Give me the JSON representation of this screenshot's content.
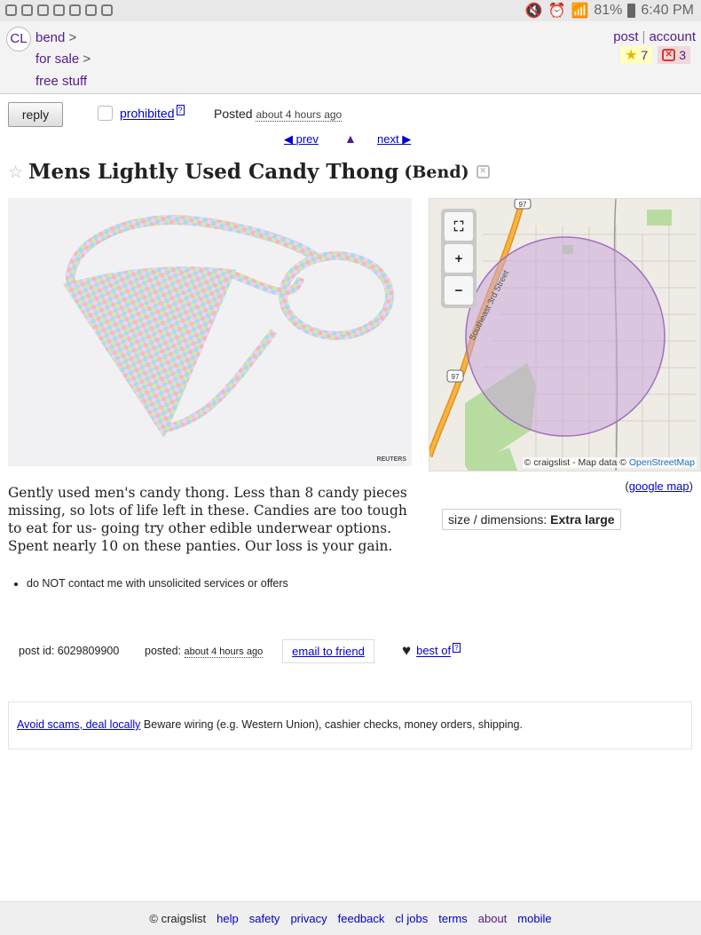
{
  "status_bar": {
    "battery": "81%",
    "time": "6:40 PM"
  },
  "header": {
    "logo": "CL",
    "breadcrumbs": [
      "bend",
      "for sale",
      "free stuff"
    ],
    "post_label": "post",
    "account_label": "account",
    "favorites_count": "7",
    "hidden_count": "3"
  },
  "actions": {
    "reply_label": "reply",
    "prohibited_label": "prohibited",
    "help_mark": "?",
    "posted_label": "Posted",
    "posted_time": "about 4 hours ago",
    "prev_label": "prev",
    "next_label": "next"
  },
  "posting": {
    "title": "Mens Lightly Used Candy Thong",
    "location": "(Bend)",
    "image_watermark": "REUTERS",
    "body": "Gently used men's candy thong. Less than 8 candy pieces missing, so lots of life left in these. Candies are too tough to eat for us- going try other edible underwear options. Spent nearly 10 on these panties. Our loss is your gain.",
    "notice": "do NOT contact me with unsolicited services or offers"
  },
  "map": {
    "road_label": "Southeast 3rd Street",
    "shield_1": "97",
    "shield_2": "97",
    "attribution": "© craigslist - Map data ©",
    "osm_label": "OpenStreetMap",
    "google_link": "google map",
    "controls": {
      "fullscreen": "⛶",
      "zoom_in": "+",
      "zoom_out": "−"
    }
  },
  "attributes": {
    "label": "size / dimensions:",
    "value": "Extra large"
  },
  "post_info": {
    "post_id": "post id: 6029809900",
    "posted_label": "posted:",
    "posted_time": "about 4 hours ago",
    "email_label": "email to friend",
    "best_of_label": "best of"
  },
  "scams": {
    "link": "Avoid scams, deal locally",
    "text": "Beware wiring (e.g. Western Union), cashier checks, money orders, shipping."
  },
  "footer": {
    "copyright": "© craigslist",
    "links": [
      "help",
      "safety",
      "privacy",
      "feedback",
      "cl jobs",
      "terms",
      "about",
      "mobile"
    ]
  },
  "colors": {
    "link": "#0000cc",
    "visited": "#551a8b",
    "map_circle": "#c9a8d8",
    "highway": "#f0a020"
  }
}
